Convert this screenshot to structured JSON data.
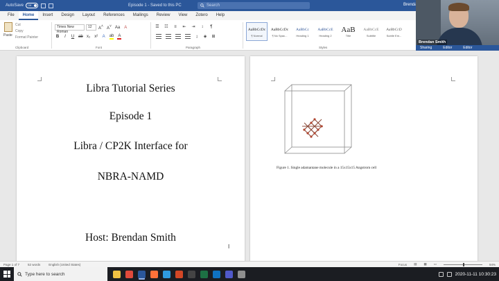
{
  "titlebar": {
    "autosave_label": "AutoSave",
    "autosave_state": "Off",
    "doc_title": "Episode 1 - Saved to this PC",
    "search_placeholder": "Search",
    "user": "Brendan"
  },
  "menu": {
    "tabs": [
      "File",
      "Home",
      "Insert",
      "Design",
      "Layout",
      "References",
      "Mailings",
      "Review",
      "View",
      "Zotero",
      "Help"
    ],
    "active": "Home"
  },
  "ribbon": {
    "paste_label": "Paste",
    "clipboard_items": [
      "Cut",
      "Copy",
      "Format Painter"
    ],
    "clipboard_group": "Clipboard",
    "font_name": "Times New Roman",
    "font_size": "12",
    "font_group": "Font",
    "paragraph_group": "Paragraph",
    "styles_group": "Styles",
    "styles": [
      {
        "preview": "AaBbCcDc",
        "name": "¶ Normal"
      },
      {
        "preview": "AaBbCcDc",
        "name": "¶ No Spac..."
      },
      {
        "preview": "AaBbCc",
        "name": "Heading 1"
      },
      {
        "preview": "AaBbCcE",
        "name": "Heading 2"
      },
      {
        "preview": "AaB",
        "name": "Title"
      },
      {
        "preview": "AaBbCcE",
        "name": "Subtitle"
      },
      {
        "preview": "AaBbCcD",
        "name": "Subtle Em..."
      }
    ]
  },
  "webcam": {
    "name": "Brendan Smith",
    "strip_items": [
      "Sharing",
      "Editor",
      "Editor"
    ]
  },
  "page1": {
    "lines": [
      "Libra Tutorial Series",
      "Episode 1",
      "Libra / CP2K Interface for",
      "NBRA-NAMD",
      "Host: Brendan Smith"
    ]
  },
  "page2": {
    "caption": "Figure 1. Single adamantane molecule in a 15x15x15 Angstrom cell"
  },
  "statusbar": {
    "page": "Page 1 of 7",
    "words": "52 words",
    "language": "English (United States)",
    "focus": "Focus",
    "zoom": "94%"
  },
  "taskbar": {
    "search_placeholder": "Type here to search",
    "datetime": "2020-11-11 10:30:23",
    "apps": [
      {
        "name": "file-explorer-icon",
        "color": "#f0c243"
      },
      {
        "name": "chrome-icon",
        "color": "#e04a3b"
      },
      {
        "name": "word-icon",
        "color": "#2b579a"
      },
      {
        "name": "firefox-icon",
        "color": "#ff7139"
      },
      {
        "name": "edge-icon",
        "color": "#2f9be0"
      },
      {
        "name": "powerpoint-icon",
        "color": "#d24726"
      },
      {
        "name": "terminal-icon",
        "color": "#444"
      },
      {
        "name": "excel-icon",
        "color": "#1d7044"
      },
      {
        "name": "outlook-icon",
        "color": "#0f72c2"
      },
      {
        "name": "teams-icon",
        "color": "#5059c9"
      },
      {
        "name": "notes-icon",
        "color": "#8f8f8f"
      }
    ]
  }
}
